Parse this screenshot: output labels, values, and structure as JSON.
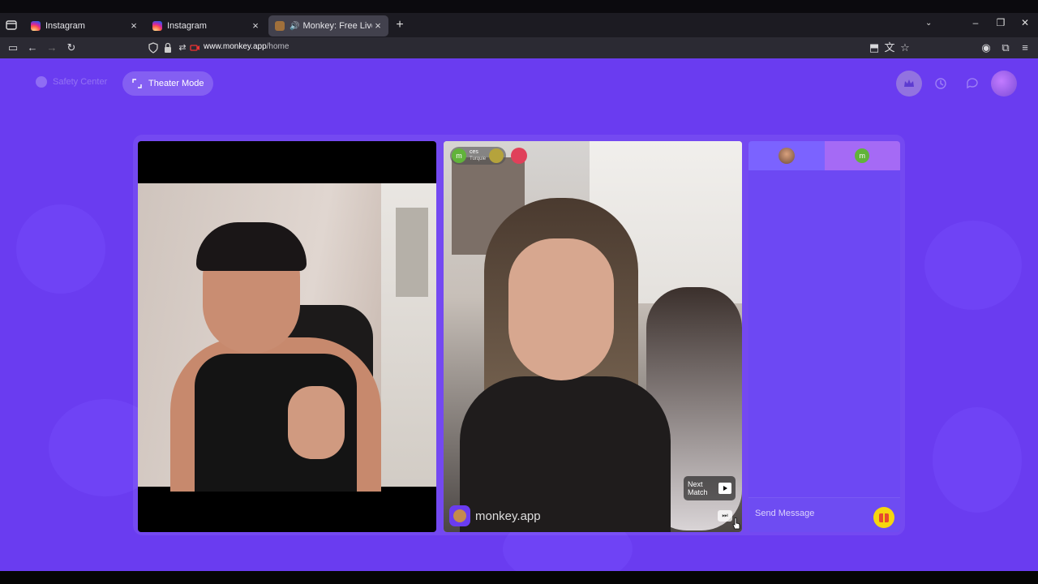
{
  "browser": {
    "tabs": [
      {
        "title": "Instagram",
        "favicon": "instagram-icon",
        "active": false
      },
      {
        "title": "Instagram",
        "favicon": "instagram-icon",
        "active": false
      },
      {
        "title": "Monkey: Free Live Video Ch",
        "favicon": "monkey-icon",
        "active": true,
        "audio": true
      }
    ],
    "new_tab": "+",
    "url_host": "www.monkey.app",
    "url_path": "/home"
  },
  "header": {
    "safety_center": "Safety Center",
    "theater_mode": "Theater Mode"
  },
  "partner": {
    "badge_letter": "m",
    "badge_name": "ces",
    "badge_sub": "Turquie"
  },
  "watermark": "monkey.app",
  "next_match": {
    "line1": "Next",
    "line2": "Match"
  },
  "chat": {
    "tab2_letter": "m",
    "placeholder": "Send Message"
  },
  "colors": {
    "page_bg": "#6a3cf0",
    "chat_panel": "#6d48f3",
    "gift_button": "#f6d60e",
    "badge_green": "#61b33a"
  }
}
